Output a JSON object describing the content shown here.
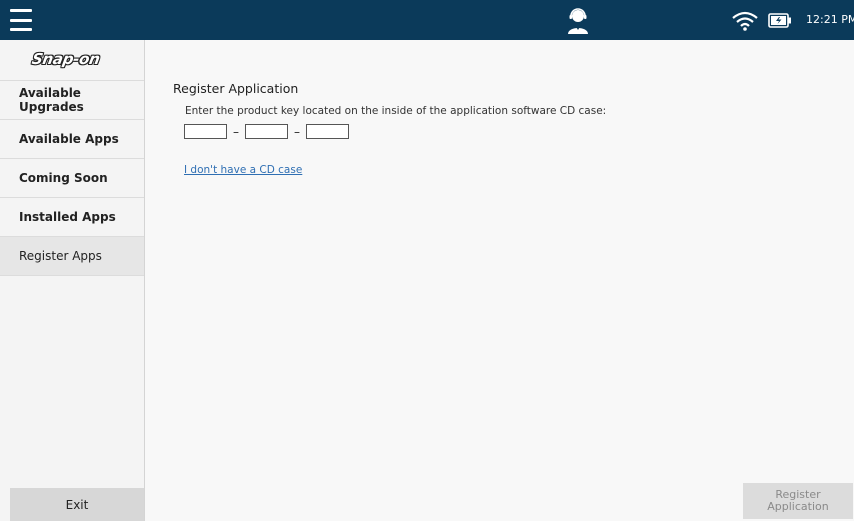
{
  "topbar": {
    "menu_icon": "hamburger-menu-icon",
    "support_icon": "technician-headset-icon",
    "wifi_icon": "wifi-icon",
    "battery_icon": "battery-charging-icon",
    "time": "12:21 PM",
    "background_color": "#0b3a5a"
  },
  "sidebar": {
    "logo_text": "Snap-on",
    "items": [
      {
        "label": "Available Upgrades"
      },
      {
        "label": "Available Apps"
      },
      {
        "label": "Coming Soon"
      },
      {
        "label": "Installed Apps"
      },
      {
        "label": "Register Apps",
        "active": true
      }
    ],
    "exit_label": "Exit"
  },
  "main": {
    "title": "Register Application",
    "instruction": "Enter the product key located on the inside of the application software CD case:",
    "key_fields": [
      "",
      "",
      ""
    ],
    "key_separator": "–",
    "no_cd_link": "I don't have a CD case",
    "register_button": "Register Application"
  }
}
